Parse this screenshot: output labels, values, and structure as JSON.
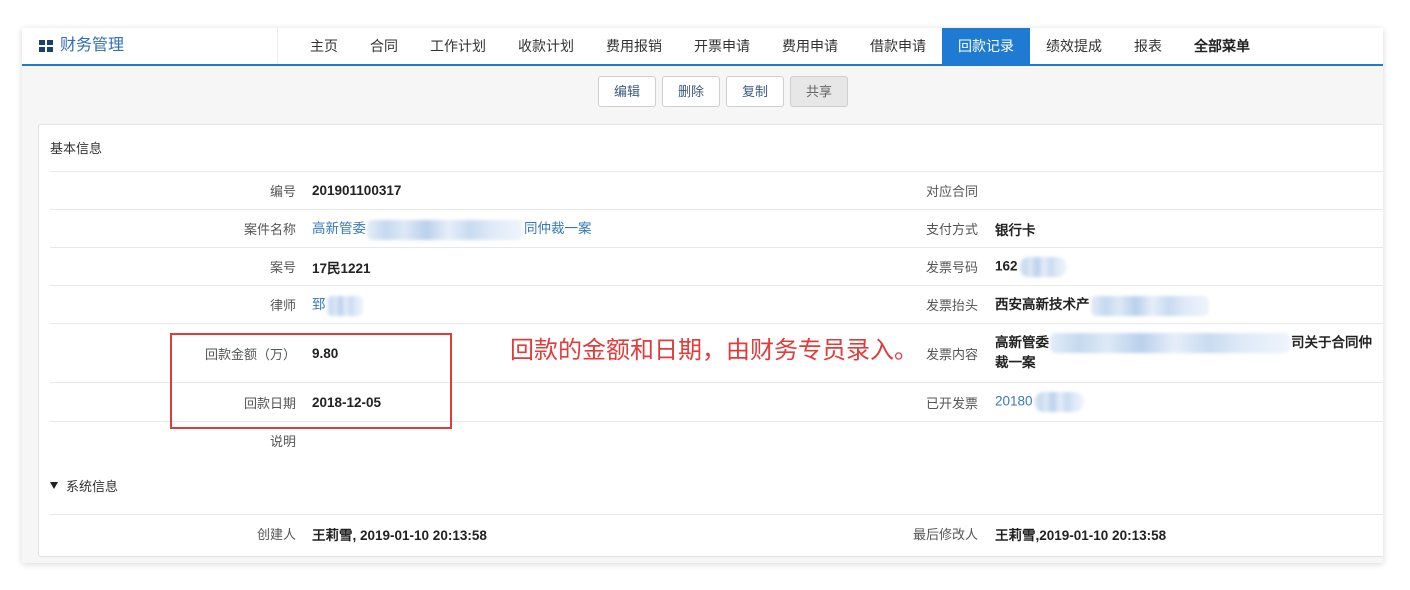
{
  "app": {
    "title": "财务管理",
    "logo_icon": "grid-icon"
  },
  "nav": {
    "tabs": [
      {
        "label": "主页"
      },
      {
        "label": "合同"
      },
      {
        "label": "工作计划"
      },
      {
        "label": "收款计划"
      },
      {
        "label": "费用报销"
      },
      {
        "label": "开票申请"
      },
      {
        "label": "费用申请"
      },
      {
        "label": "借款申请"
      },
      {
        "label": "回款记录",
        "active": true
      },
      {
        "label": "绩效提成"
      },
      {
        "label": "报表"
      },
      {
        "label": "全部菜单"
      }
    ]
  },
  "toolbar": {
    "buttons": [
      {
        "label": "编辑"
      },
      {
        "label": "删除"
      },
      {
        "label": "复制"
      },
      {
        "label": "共享"
      }
    ]
  },
  "basic_info": {
    "title": "基本信息",
    "number": {
      "label": "编号",
      "value": "201901100317"
    },
    "contract": {
      "label": "对应合同"
    },
    "case_name": {
      "label": "案件名称",
      "value_start": "高新管委",
      "value_end": "同仲裁一案"
    },
    "payment_method": {
      "label": "支付方式",
      "value": "银行卡"
    },
    "case_no": {
      "label": "案号",
      "value": "17民1221"
    },
    "invoice_no": {
      "label": "发票号码",
      "value_start": "162"
    },
    "lawyer": {
      "label": "律师",
      "value_start": "郅"
    },
    "invoice_title": {
      "label": "发票抬头",
      "value_start": "西安高新技术产"
    },
    "amount": {
      "label": "回款金额（万）",
      "value": "9.80"
    },
    "invoice_content": {
      "label": "发票内容",
      "value_start": "高新管委",
      "value_end": "司关于合同仲",
      "value_line2": "裁一案"
    },
    "date": {
      "label": "回款日期",
      "value": "2018-12-05"
    },
    "issued_invoice": {
      "label": "已开发票",
      "value_start": "20180"
    },
    "note": {
      "label": "说明"
    }
  },
  "system_info": {
    "title": "系统信息",
    "toggle_icon": "caret-down-icon",
    "creator": {
      "label": "创建人",
      "value": "王莉雪, 2019-01-10 20:13:58"
    },
    "modifier": {
      "label": "最后修改人",
      "value": "王莉雪,2019-01-10 20:13:58"
    }
  },
  "annotation": {
    "text": "回款的金额和日期，由财务专员录入。"
  },
  "colors": {
    "accent": "#1f7bd1",
    "link": "#3579b8",
    "annotation": "#e03c3c",
    "logo_text": "#2f6db5"
  }
}
